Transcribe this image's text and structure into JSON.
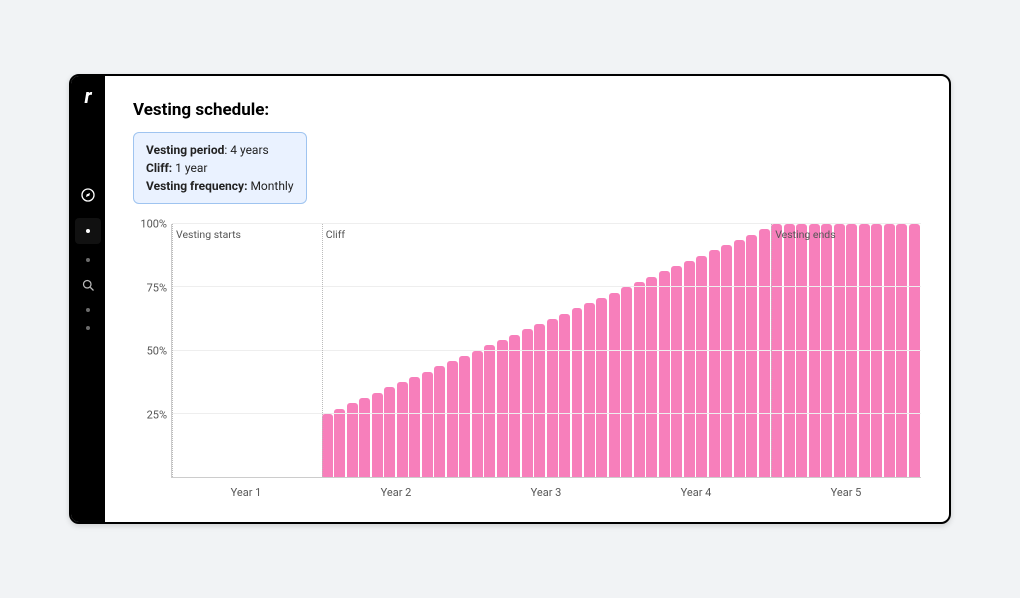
{
  "title": "Vesting schedule:",
  "info": {
    "period_label": "Vesting period",
    "period_value": "4 years",
    "cliff_label": "Cliff:",
    "cliff_value": "1 year",
    "freq_label": "Vesting frequency:",
    "freq_value": "Monthly"
  },
  "chart_data": {
    "type": "bar",
    "title": "Vesting schedule",
    "xlabel": "",
    "ylabel": "",
    "ylim": [
      0,
      100
    ],
    "y_ticks": [
      25,
      50,
      75,
      100
    ],
    "y_tick_labels": [
      "25%",
      "50%",
      "75%",
      "100%"
    ],
    "x_categories": [
      "Year 1",
      "Year 2",
      "Year 3",
      "Year 4",
      "Year 5"
    ],
    "markers": [
      {
        "label": "Vesting starts",
        "month": 0
      },
      {
        "label": "Cliff",
        "month": 12
      },
      {
        "label": "Vesting ends",
        "month": 48
      }
    ],
    "total_months": 60,
    "values": [
      0,
      0,
      0,
      0,
      0,
      0,
      0,
      0,
      0,
      0,
      0,
      0,
      25.0,
      27.08,
      29.17,
      31.25,
      33.33,
      35.42,
      37.5,
      39.58,
      41.67,
      43.75,
      45.83,
      47.92,
      50.0,
      52.08,
      54.17,
      56.25,
      58.33,
      60.42,
      62.5,
      64.58,
      66.67,
      68.75,
      70.83,
      72.92,
      75.0,
      77.08,
      79.17,
      81.25,
      83.33,
      85.42,
      87.5,
      89.58,
      91.67,
      93.75,
      95.83,
      97.92,
      100,
      100,
      100,
      100,
      100,
      100,
      100,
      100,
      100,
      100,
      100,
      100
    ],
    "bar_color": "#f77fbb"
  }
}
